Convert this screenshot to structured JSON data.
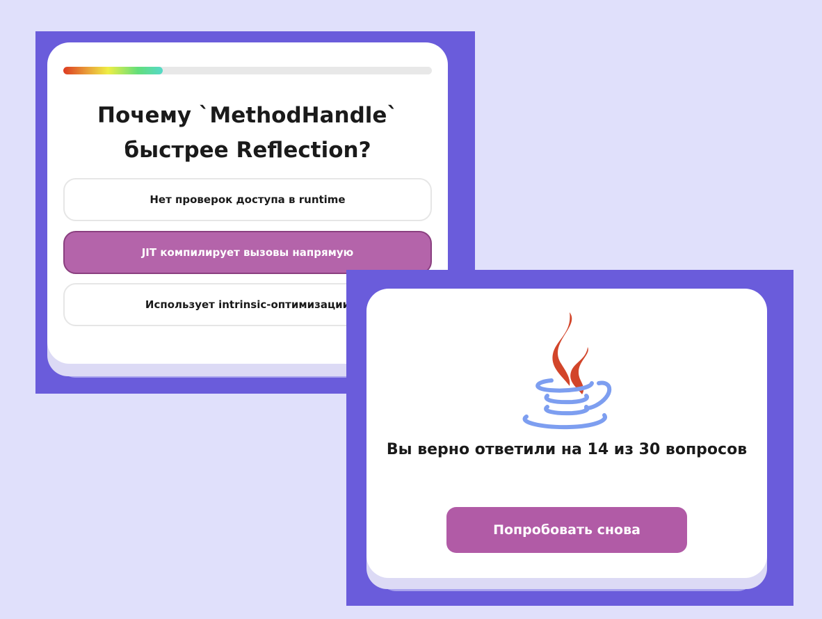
{
  "quiz": {
    "progress": 0.27,
    "question": "Почему `MethodHandle` быстрее Reflection?",
    "options": [
      {
        "label": "Нет проверок доступа в runtime",
        "selected": false
      },
      {
        "label": "JIT компилирует вызовы напрямую",
        "selected": true
      },
      {
        "label": "Использует intrinsic-оптимизации",
        "selected": false
      }
    ]
  },
  "result": {
    "logo_icon": "java-coffee-cup-icon",
    "summary": "Вы верно ответили на 14 из 30 вопросов",
    "retry_label": "Попробовать снова"
  },
  "colors": {
    "background": "#e0e0fb",
    "panel": "#6a5cdb",
    "accent": "#b464aa",
    "steam": "#d2452a",
    "cup": "#7d9ef0"
  }
}
